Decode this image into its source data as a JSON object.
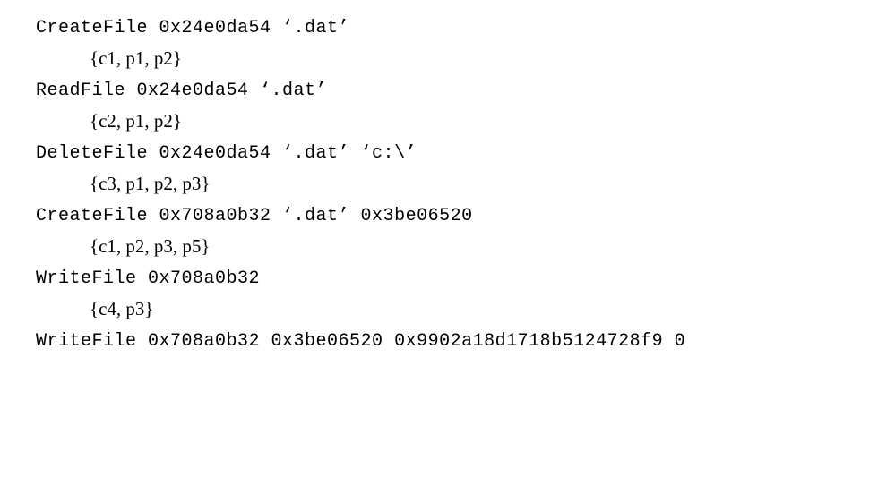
{
  "entries": [
    {
      "cmd": "CreateFile 0x24e0da54 ‘.dat’",
      "set": "{c1, p1, p2}"
    },
    {
      "cmd": "ReadFile 0x24e0da54 ‘.dat’",
      "set": "{c2, p1, p2}"
    },
    {
      "cmd": "DeleteFile 0x24e0da54 ‘.dat’ ‘c:\\’",
      "set": "{c3, p1, p2, p3}"
    },
    {
      "cmd": "CreateFile 0x708a0b32 ‘.dat’ 0x3be06520",
      "set": "{c1, p2, p3, p5}"
    },
    {
      "cmd": "WriteFile 0x708a0b32",
      "set": "{c4, p3}"
    },
    {
      "cmd": "WriteFile 0x708a0b32 0x3be06520 0x9902a18d1718b5124728f9 0",
      "set": ""
    }
  ]
}
